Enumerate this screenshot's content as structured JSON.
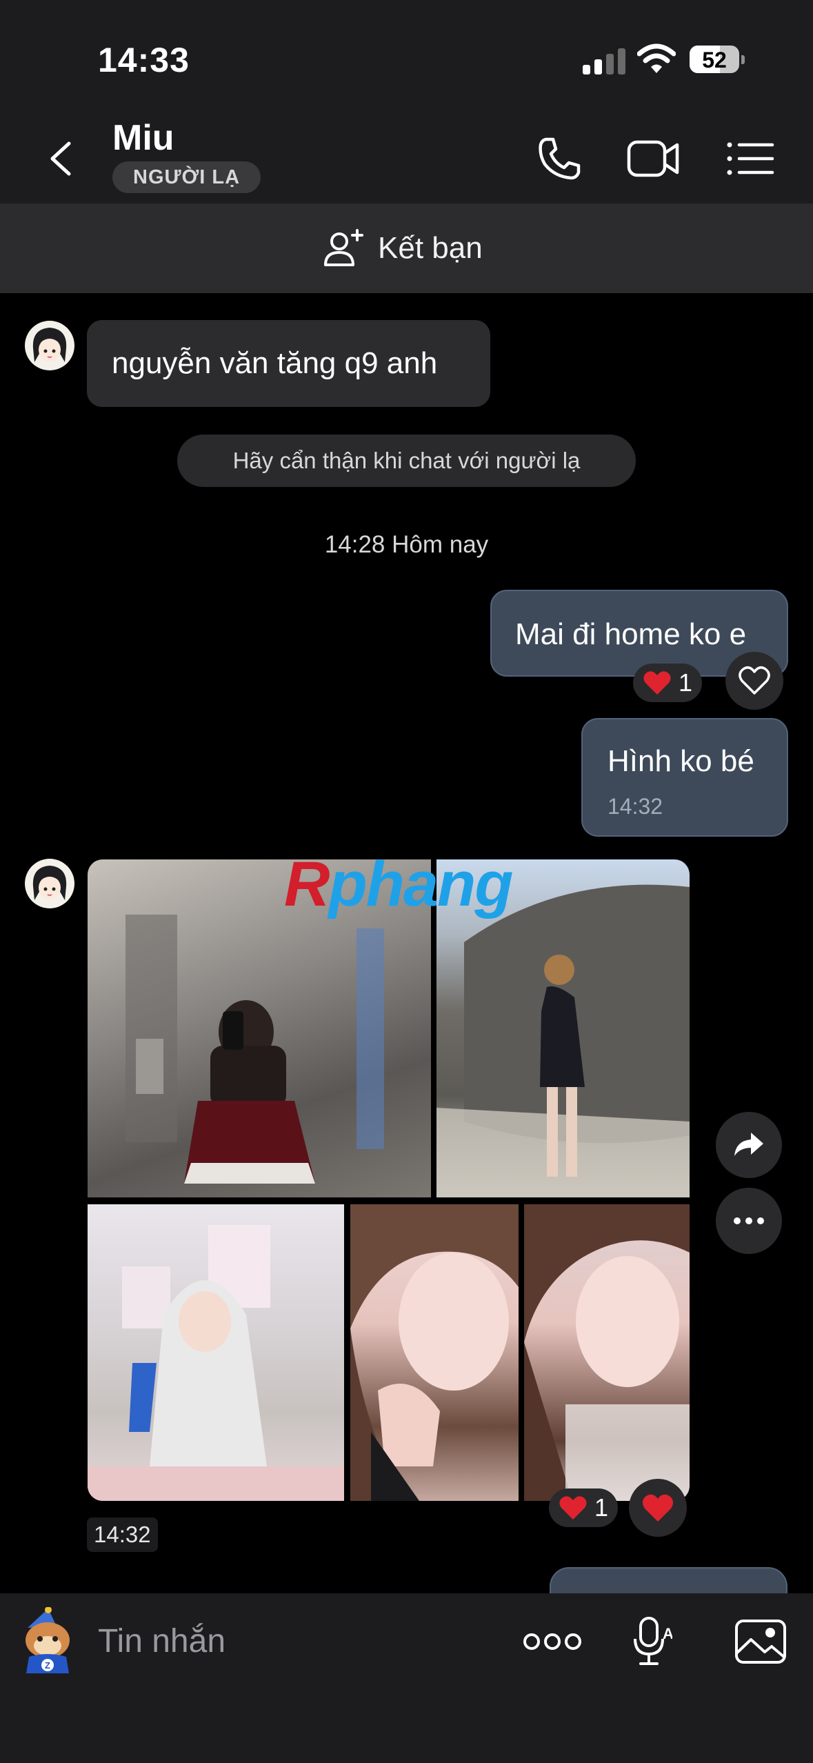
{
  "status_bar": {
    "time": "14:33",
    "battery": "52"
  },
  "header": {
    "contact_name": "Miu",
    "badge": "NGƯỜI LẠ",
    "icons": [
      "back-icon",
      "phone-icon",
      "video-call-icon",
      "menu-list-icon"
    ]
  },
  "add_friend": {
    "label": "Kết bạn",
    "icon": "add-user-icon"
  },
  "messages": {
    "incoming_1": "nguyễn văn tăng q9 anh",
    "system_note": "Hãy cẩn thận khi chat với người lạ",
    "day_stamp": "14:28 Hôm nay",
    "outgoing_1": "Mai đi home ko e",
    "outgoing_1_reaction_count": "1",
    "outgoing_2": "Hình ko bé",
    "outgoing_2_time": "14:32",
    "photos_reaction_count": "1",
    "photos_time": "14:32"
  },
  "watermark": {
    "part1": "R",
    "part2": "phang"
  },
  "input_bar": {
    "placeholder": "Tin nhắn",
    "icons": [
      "sticker-icon",
      "more-dots-icon",
      "voice-to-text-icon",
      "image-gallery-icon"
    ]
  },
  "colors": {
    "background": "#000000",
    "bar": "#1c1c1e",
    "incoming_bubble": "#2c2c2e",
    "outgoing_bubble": "#3e4a5a",
    "heart": "#e0242f"
  }
}
